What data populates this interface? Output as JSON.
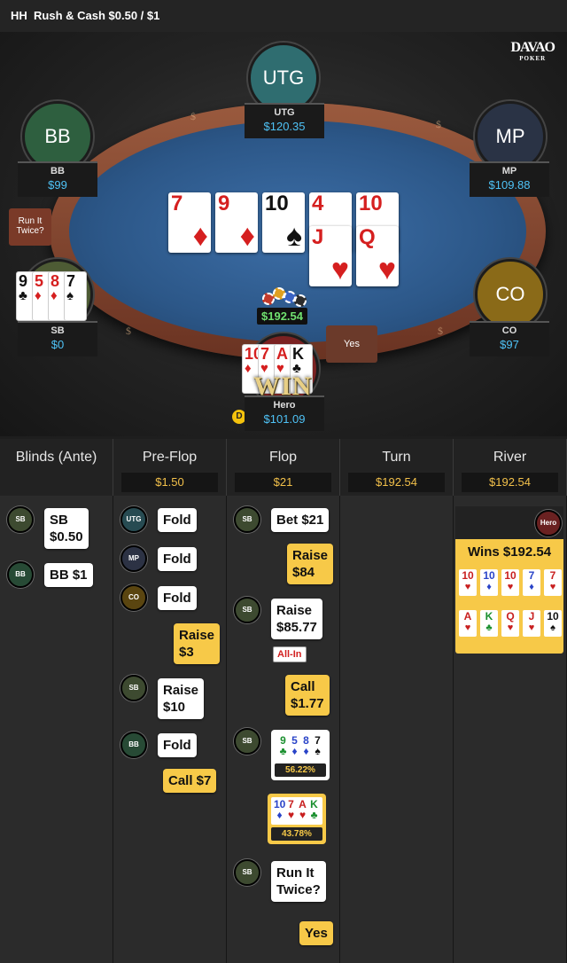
{
  "topbar": {
    "game": "HH",
    "title": "Rush & Cash $0.50 / $1"
  },
  "logo": {
    "line1": "DAVAO",
    "line2": "POKER"
  },
  "colors": {
    "pot_green": "#6fe06f",
    "stack_blue": "#4fc3f7",
    "history_yellow": "#f7c948",
    "felt": "#2c5788"
  },
  "seats": {
    "utg": {
      "position": "UTG",
      "stack": "$120.35",
      "avatar_label": "UTG"
    },
    "bb": {
      "position": "BB",
      "stack": "$99",
      "avatar_label": "BB"
    },
    "mp": {
      "position": "MP",
      "stack": "$109.88",
      "avatar_label": "MP"
    },
    "sb": {
      "position": "SB",
      "stack": "$0"
    },
    "co": {
      "position": "CO",
      "stack": "$97",
      "avatar_label": "CO"
    },
    "hero": {
      "position": "Hero",
      "stack": "$101.09"
    }
  },
  "board": {
    "run1": [
      {
        "rank": "7",
        "suit": "♦",
        "color": "red"
      },
      {
        "rank": "9",
        "suit": "♦",
        "color": "red"
      },
      {
        "rank": "10",
        "suit": "♠",
        "color": "black"
      },
      {
        "rank": "4",
        "suit": "♥",
        "color": "red"
      },
      {
        "rank": "10",
        "suit": "♥",
        "color": "red"
      }
    ],
    "run2": [
      {
        "rank": "J",
        "suit": "♥",
        "color": "red"
      },
      {
        "rank": "Q",
        "suit": "♥",
        "color": "red"
      }
    ]
  },
  "sb_hand": [
    {
      "rank": "9",
      "suit": "♣",
      "color": "black"
    },
    {
      "rank": "5",
      "suit": "♦",
      "color": "red"
    },
    {
      "rank": "8",
      "suit": "♦",
      "color": "red"
    },
    {
      "rank": "7",
      "suit": "♠",
      "color": "black"
    }
  ],
  "hero_hand": [
    {
      "rank": "10",
      "suit": "♦",
      "color": "red"
    },
    {
      "rank": "7",
      "suit": "♥",
      "color": "red"
    },
    {
      "rank": "A",
      "suit": "♥",
      "color": "red"
    },
    {
      "rank": "K",
      "suit": "♣",
      "color": "black"
    }
  ],
  "pot": "$192.54",
  "win_text": "WIN",
  "run_it_twice_btn": "Run It Twice?",
  "yes_btn": "Yes",
  "dealer_button": "D",
  "history": {
    "columns": [
      {
        "title": "Blinds (Ante)",
        "pot": ""
      },
      {
        "title": "Pre-Flop",
        "pot": "$1.50"
      },
      {
        "title": "Flop",
        "pot": "$21"
      },
      {
        "title": "Turn",
        "pot": "$192.54"
      },
      {
        "title": "River",
        "pot": "$192.54"
      }
    ],
    "blinds": [
      {
        "badge": "SB",
        "text1": "SB",
        "text2": "$0.50"
      },
      {
        "badge": "BB",
        "text1": "BB $1"
      }
    ],
    "preflop": [
      {
        "badge": "UTG",
        "text": "Fold"
      },
      {
        "badge": "MP",
        "text": "Fold"
      },
      {
        "badge": "CO",
        "text": "Fold"
      },
      {
        "text1": "Raise",
        "text2": "$3"
      },
      {
        "badge": "SB",
        "text1": "Raise",
        "text2": "$10"
      },
      {
        "badge": "BB",
        "text": "Fold"
      },
      {
        "text": "Call $7"
      }
    ],
    "flop": [
      {
        "badge": "SB",
        "text": "Bet $21"
      },
      {
        "text1": "Raise",
        "text2": "$84"
      },
      {
        "badge": "SB",
        "text1": "Raise",
        "text2": "$85.77",
        "tag": "All-In"
      },
      {
        "text1": "Call",
        "text2": "$1.77"
      },
      {
        "badge": "SB",
        "cards": [
          {
            "rank": "9",
            "suit": "♣",
            "color": "#1a8f2e"
          },
          {
            "rank": "5",
            "suit": "♦",
            "color": "#2a44c8"
          },
          {
            "rank": "8",
            "suit": "♦",
            "color": "#2a44c8"
          },
          {
            "rank": "7",
            "suit": "♠",
            "color": "#111"
          }
        ],
        "equity": "56.22%"
      },
      {
        "cards": [
          {
            "rank": "10",
            "suit": "♦",
            "color": "#2a44c8"
          },
          {
            "rank": "7",
            "suit": "♥",
            "color": "#c81f1f"
          },
          {
            "rank": "A",
            "suit": "♥",
            "color": "#c81f1f"
          },
          {
            "rank": "K",
            "suit": "♣",
            "color": "#1a8f2e"
          }
        ],
        "equity": "43.78%"
      },
      {
        "badge": "SB",
        "text1": "Run It",
        "text2": "Twice?"
      },
      {
        "text": "Yes"
      }
    ],
    "river": {
      "badge": "Hero",
      "wins": "Wins $192.54",
      "row1": [
        {
          "rank": "10",
          "suit": "♥",
          "color": "#c81f1f"
        },
        {
          "rank": "10",
          "suit": "♦",
          "color": "#2a44c8"
        },
        {
          "rank": "10",
          "suit": "♥",
          "color": "#c81f1f"
        },
        {
          "rank": "7",
          "suit": "♦",
          "color": "#2a44c8"
        },
        {
          "rank": "7",
          "suit": "♥",
          "color": "#c81f1f"
        }
      ],
      "row2": [
        {
          "rank": "A",
          "suit": "♥",
          "color": "#c81f1f"
        },
        {
          "rank": "K",
          "suit": "♣",
          "color": "#1a8f2e"
        },
        {
          "rank": "Q",
          "suit": "♥",
          "color": "#c81f1f"
        },
        {
          "rank": "J",
          "suit": "♥",
          "color": "#c81f1f"
        },
        {
          "rank": "10",
          "suit": "♠",
          "color": "#111"
        }
      ]
    }
  }
}
